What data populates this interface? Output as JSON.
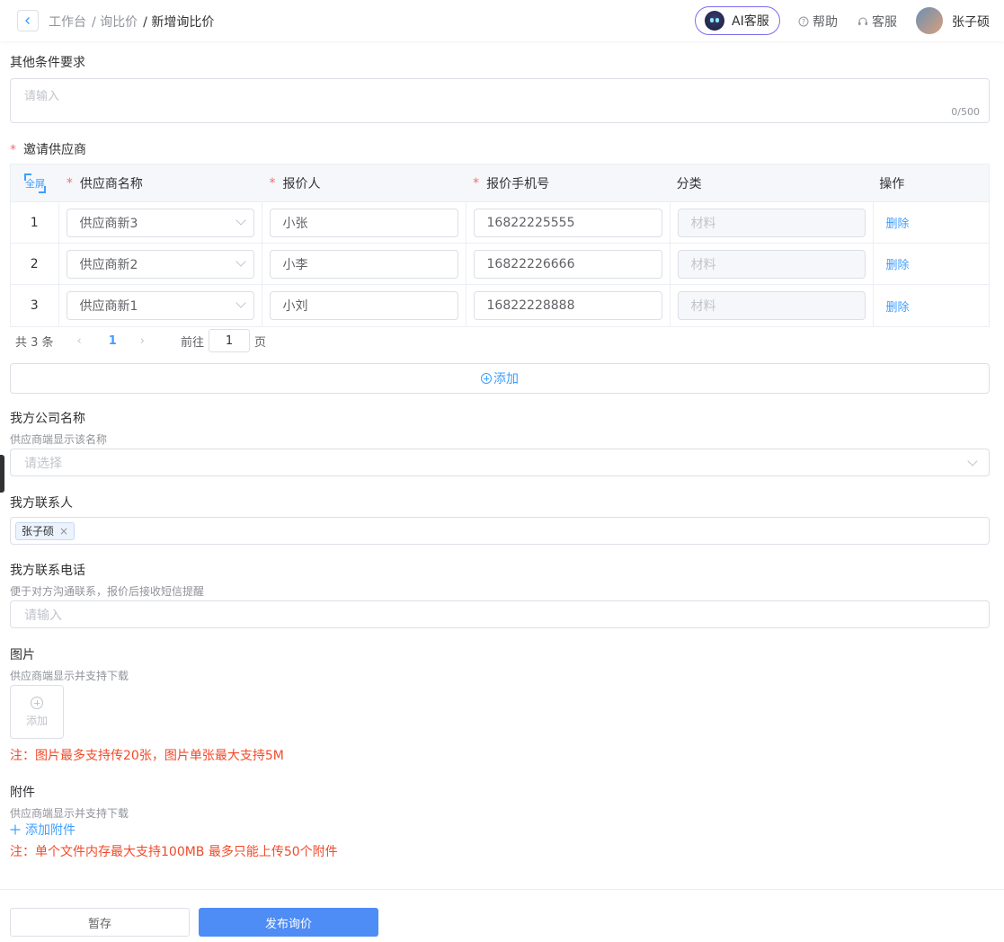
{
  "header": {
    "breadcrumb": [
      "工作台",
      "/ 询比价",
      "/ 新增询比价"
    ],
    "ai_label": "AI客服",
    "help_label": "帮助",
    "service_label": "客服",
    "user_name": "张子硕"
  },
  "other_conditions": {
    "label": "其他条件要求",
    "placeholder": "请输入",
    "counter": "0/500"
  },
  "suppliers": {
    "label": "邀请供应商",
    "fullscreen_label": "全屏",
    "columns": [
      "供应商名称",
      "报价人",
      "报价手机号",
      "分类",
      "操作"
    ],
    "rows": [
      {
        "index": "1",
        "supplier": "供应商新3",
        "quoter": "小张",
        "phone": "16822225555",
        "category": "材料",
        "action": "删除"
      },
      {
        "index": "2",
        "supplier": "供应商新2",
        "quoter": "小李",
        "phone": "16822226666",
        "category": "材料",
        "action": "删除"
      },
      {
        "index": "3",
        "supplier": "供应商新1",
        "quoter": "小刘",
        "phone": "16822228888",
        "category": "材料",
        "action": "删除"
      }
    ],
    "pagination": {
      "total": "共 3 条",
      "current": "1",
      "prev": "‹",
      "next": "›",
      "goto": "前往",
      "goto_value": "1",
      "page_unit": "页"
    },
    "add_label": "添加"
  },
  "company": {
    "label": "我方公司名称",
    "hint": "供应商端显示该名称",
    "placeholder": "请选择"
  },
  "contact": {
    "label": "我方联系人",
    "tag": "张子硕",
    "tag_close": "×"
  },
  "phone": {
    "label": "我方联系电话",
    "hint": "便于对方沟通联系，报价后接收短信提醒",
    "placeholder": "请输入"
  },
  "images": {
    "label": "图片",
    "hint": "供应商端显示并支持下载",
    "upload_label": "添加",
    "note": "注：图片最多支持传20张，图片单张最大支持5M"
  },
  "attachments": {
    "label": "附件",
    "hint": "供应商端显示并支持下载",
    "add_label": "添加附件",
    "note": "注：单个文件内存最大支持100MB 最多只能上传50个附件"
  },
  "footer": {
    "draft_label": "暂存",
    "publish_label": "发布询价"
  },
  "colors": {
    "primary": "#409eff",
    "publish": "#4e8cf6",
    "warning": "#f24a2a",
    "required": "#f56c6c"
  }
}
